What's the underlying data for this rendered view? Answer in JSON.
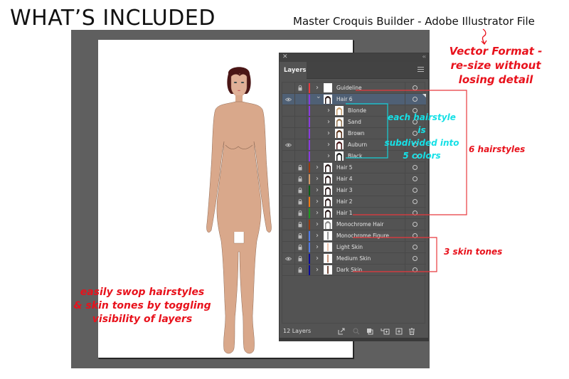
{
  "header": {
    "title": "WHAT’S INCLUDED",
    "subtitle": "Master Croquis Builder - Adobe Illustrator File"
  },
  "annotations": {
    "vector_note": [
      "Vector Format -",
      "re-size without",
      "losing detail"
    ],
    "hair_subdivision_note": [
      "each hairstyle is",
      "subdivided into",
      "5 colors"
    ],
    "hairstyles_note": "6 hairstyles",
    "skin_tones_note": "3 skin tones",
    "swap_note": [
      "easily swop hairstyles",
      "& skin tones by toggling",
      "visibility of layers"
    ]
  },
  "colors": {
    "annotation_red": "#e8121c",
    "annotation_cyan": "#16e0e6",
    "skin": "#d9a88b",
    "hair": "#4a1616",
    "panel_bg": "#535353",
    "selected_row": "#4f6075"
  },
  "layers_panel": {
    "tab_label": "Layers",
    "close_icon": "close-icon",
    "collapse_icon": "double-chevron-icon",
    "menu_icon": "hamburger-menu-icon",
    "layer_count": "12 Layers",
    "footer_icons": [
      "export-icon",
      "locate-object-icon",
      "clipping-mask-icon",
      "move-to-layer-icon",
      "new-layer-icon",
      "trash-icon"
    ],
    "rows": [
      {
        "name": "Guideline",
        "visible": false,
        "locked": true,
        "color": "#e8393d",
        "level": 0,
        "expanded": false,
        "thumb": "blank",
        "selected": false
      },
      {
        "name": "Hair 6",
        "visible": true,
        "locked": false,
        "color": "#8a3ae0",
        "level": 0,
        "expanded": true,
        "thumb": "hair-dark",
        "selected": true
      },
      {
        "name": "Blonde",
        "visible": false,
        "locked": false,
        "color": "#8a3ae0",
        "level": 1,
        "expanded": false,
        "thumb": "hair-blonde",
        "selected": false
      },
      {
        "name": "Sand",
        "visible": false,
        "locked": false,
        "color": "#8a3ae0",
        "level": 1,
        "expanded": false,
        "thumb": "hair-sand",
        "selected": false
      },
      {
        "name": "Brown",
        "visible": false,
        "locked": false,
        "color": "#8a3ae0",
        "level": 1,
        "expanded": false,
        "thumb": "hair-brown",
        "selected": false
      },
      {
        "name": "Auburn",
        "visible": true,
        "locked": false,
        "color": "#8a3ae0",
        "level": 1,
        "expanded": false,
        "thumb": "hair-auburn",
        "selected": false
      },
      {
        "name": "Black",
        "visible": false,
        "locked": false,
        "color": "#8a3ae0",
        "level": 1,
        "expanded": false,
        "thumb": "hair-black",
        "selected": false
      },
      {
        "name": "Hair 5",
        "visible": false,
        "locked": true,
        "color": "#9a3a10",
        "level": 0,
        "expanded": false,
        "thumb": "hair-dark",
        "selected": false
      },
      {
        "name": "Hair 4",
        "visible": false,
        "locked": true,
        "color": "#d29a68",
        "level": 0,
        "expanded": false,
        "thumb": "hair-dark",
        "selected": false
      },
      {
        "name": "Hair 3",
        "visible": false,
        "locked": true,
        "color": "#0f5e18",
        "level": 0,
        "expanded": false,
        "thumb": "hair-dark",
        "selected": false
      },
      {
        "name": "Hair 2",
        "visible": false,
        "locked": true,
        "color": "#f07a12",
        "level": 0,
        "expanded": false,
        "thumb": "hair-dark",
        "selected": false
      },
      {
        "name": "Hair 1",
        "visible": false,
        "locked": true,
        "color": "#1e9a1e",
        "level": 0,
        "expanded": false,
        "thumb": "hair-dark",
        "selected": false
      },
      {
        "name": "Monochrome Hair",
        "visible": false,
        "locked": true,
        "color": "#9a3a10",
        "level": 0,
        "expanded": false,
        "thumb": "hair-outline",
        "selected": false
      },
      {
        "name": "Monochrome Figure",
        "visible": false,
        "locked": true,
        "color": "#4f7ae8",
        "level": 0,
        "expanded": false,
        "thumb": "figure-grey",
        "selected": false
      },
      {
        "name": "Light Skin",
        "visible": false,
        "locked": true,
        "color": "#4f7ae8",
        "level": 0,
        "expanded": false,
        "thumb": "figure-light",
        "selected": false
      },
      {
        "name": "Medium Skin",
        "visible": true,
        "locked": true,
        "color": "#0a0a9a",
        "level": 0,
        "expanded": false,
        "thumb": "figure-medium",
        "selected": false
      },
      {
        "name": "Dark Skin",
        "visible": false,
        "locked": true,
        "color": "#0a0a9a",
        "level": 0,
        "expanded": false,
        "thumb": "figure-dark",
        "selected": false
      }
    ]
  }
}
